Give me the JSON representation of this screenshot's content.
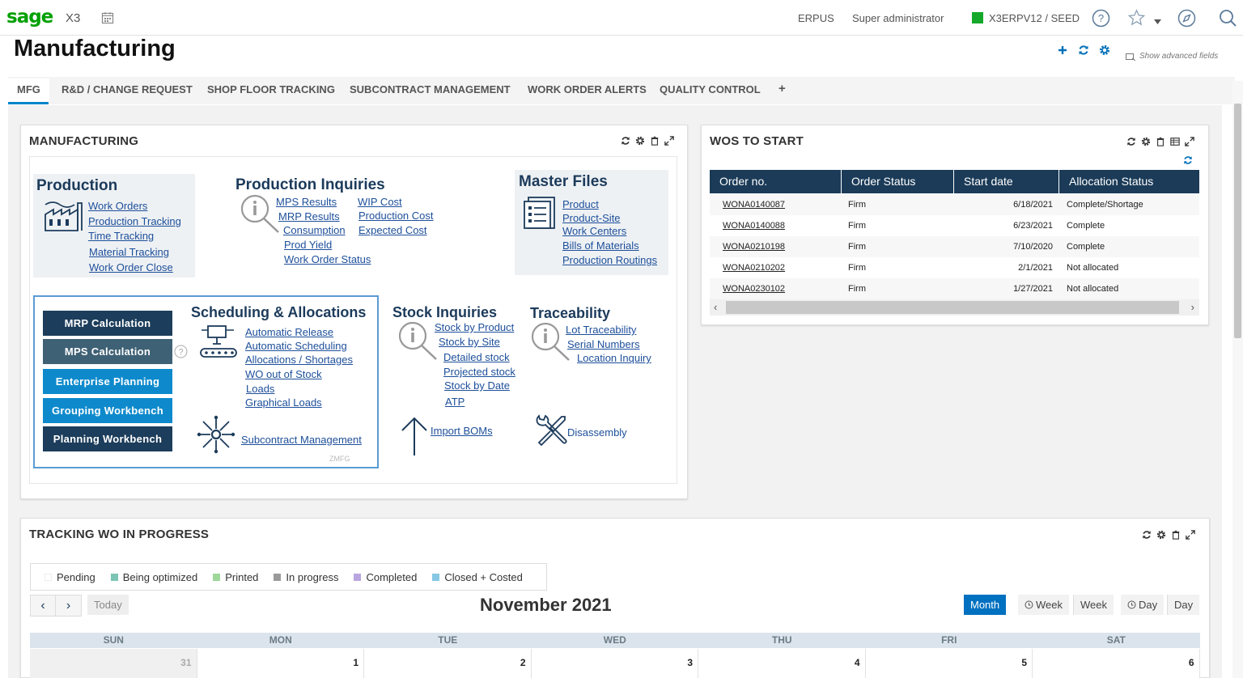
{
  "topbar": {
    "logo": "sage",
    "product": "X3",
    "endpoint": "ERPUS",
    "user": "Super administrator",
    "folder": "X3ERPV12 / SEED",
    "status_color": "#15a82a"
  },
  "page": {
    "title": "Manufacturing",
    "advanced_fields": "Show advanced fields"
  },
  "tabs": [
    "MFG",
    "R&D / CHANGE REQUEST",
    "SHOP FLOOR TRACKING",
    "SUBCONTRACT MANAGEMENT",
    "WORK ORDER ALERTS",
    "QUALITY CONTROL",
    "+"
  ],
  "manufacturing": {
    "title": "MANUFACTURING",
    "production": {
      "title": "Production",
      "links": [
        "Work Orders",
        "Production Tracking",
        "Time Tracking",
        "Material Tracking",
        "Work Order Close"
      ]
    },
    "inquiries": {
      "title": "Production Inquiries",
      "links_left": [
        "MPS Results",
        "MRP Results",
        "Consumption",
        "Prod Yield",
        "Work Order Status"
      ],
      "links_right": [
        "WIP Cost",
        "Production Cost",
        "Expected Cost"
      ]
    },
    "master": {
      "title": "Master Files",
      "links": [
        "Product",
        "Product-Site",
        "Work Centers",
        "Bills of Materials",
        "Production Routings"
      ]
    },
    "buttons": [
      "MRP Calculation",
      "MPS Calculation",
      "Enterprise Planning",
      "Grouping Workbench",
      "Planning Workbench"
    ],
    "scheduling": {
      "title": "Scheduling & Allocations",
      "links": [
        "Automatic Release",
        "Automatic Scheduling",
        "Allocations / Shortages",
        "WO out of Stock",
        "Loads",
        "Graphical Loads"
      ],
      "subcontract": "Subcontract Management",
      "code": "ZMFG"
    },
    "stock": {
      "title": "Stock Inquiries",
      "links": [
        "Stock by Product",
        "Stock by Site",
        "Detailed stock",
        "Projected stock",
        "Stock by Date",
        "ATP"
      ],
      "import": "Import BOMs"
    },
    "trace": {
      "title": "Traceability",
      "links": [
        "Lot Traceability",
        "Serial Numbers",
        "Location Inquiry"
      ],
      "disassembly": "Disassembly"
    }
  },
  "wos": {
    "title": "WOS TO START",
    "columns": [
      "Order no.",
      "Order Status",
      "Start date",
      "Allocation Status"
    ],
    "rows": [
      [
        "WONA0140087",
        "Firm",
        "6/18/2021",
        "Complete/Shortage"
      ],
      [
        "WONA0140088",
        "Firm",
        "6/23/2021",
        "Complete"
      ],
      [
        "WONA0210198",
        "Firm",
        "7/10/2020",
        "Complete"
      ],
      [
        "WONA0210202",
        "Firm",
        "2/1/2021",
        "Not allocated"
      ],
      [
        "WONA0230102",
        "Firm",
        "1/27/2021",
        "Not allocated"
      ]
    ]
  },
  "tracking": {
    "title": "TRACKING WO IN PROGRESS",
    "legend": [
      {
        "label": "Pending",
        "color": "#ffffff"
      },
      {
        "label": "Being optimized",
        "color": "#7cc4b4"
      },
      {
        "label": "Printed",
        "color": "#9ed79a"
      },
      {
        "label": "In progress",
        "color": "#9a9a9a"
      },
      {
        "label": "Completed",
        "color": "#b9a6e0"
      },
      {
        "label": "Closed + Costed",
        "color": "#86c7e4"
      }
    ],
    "today": "Today",
    "month_title": "November 2021",
    "views": [
      "Month",
      "Week",
      "Week",
      "Day",
      "Day"
    ],
    "days": [
      "SUN",
      "MON",
      "TUE",
      "WED",
      "THU",
      "FRI",
      "SAT"
    ],
    "dates": [
      "31",
      "1",
      "2",
      "3",
      "4",
      "5",
      "6"
    ]
  }
}
